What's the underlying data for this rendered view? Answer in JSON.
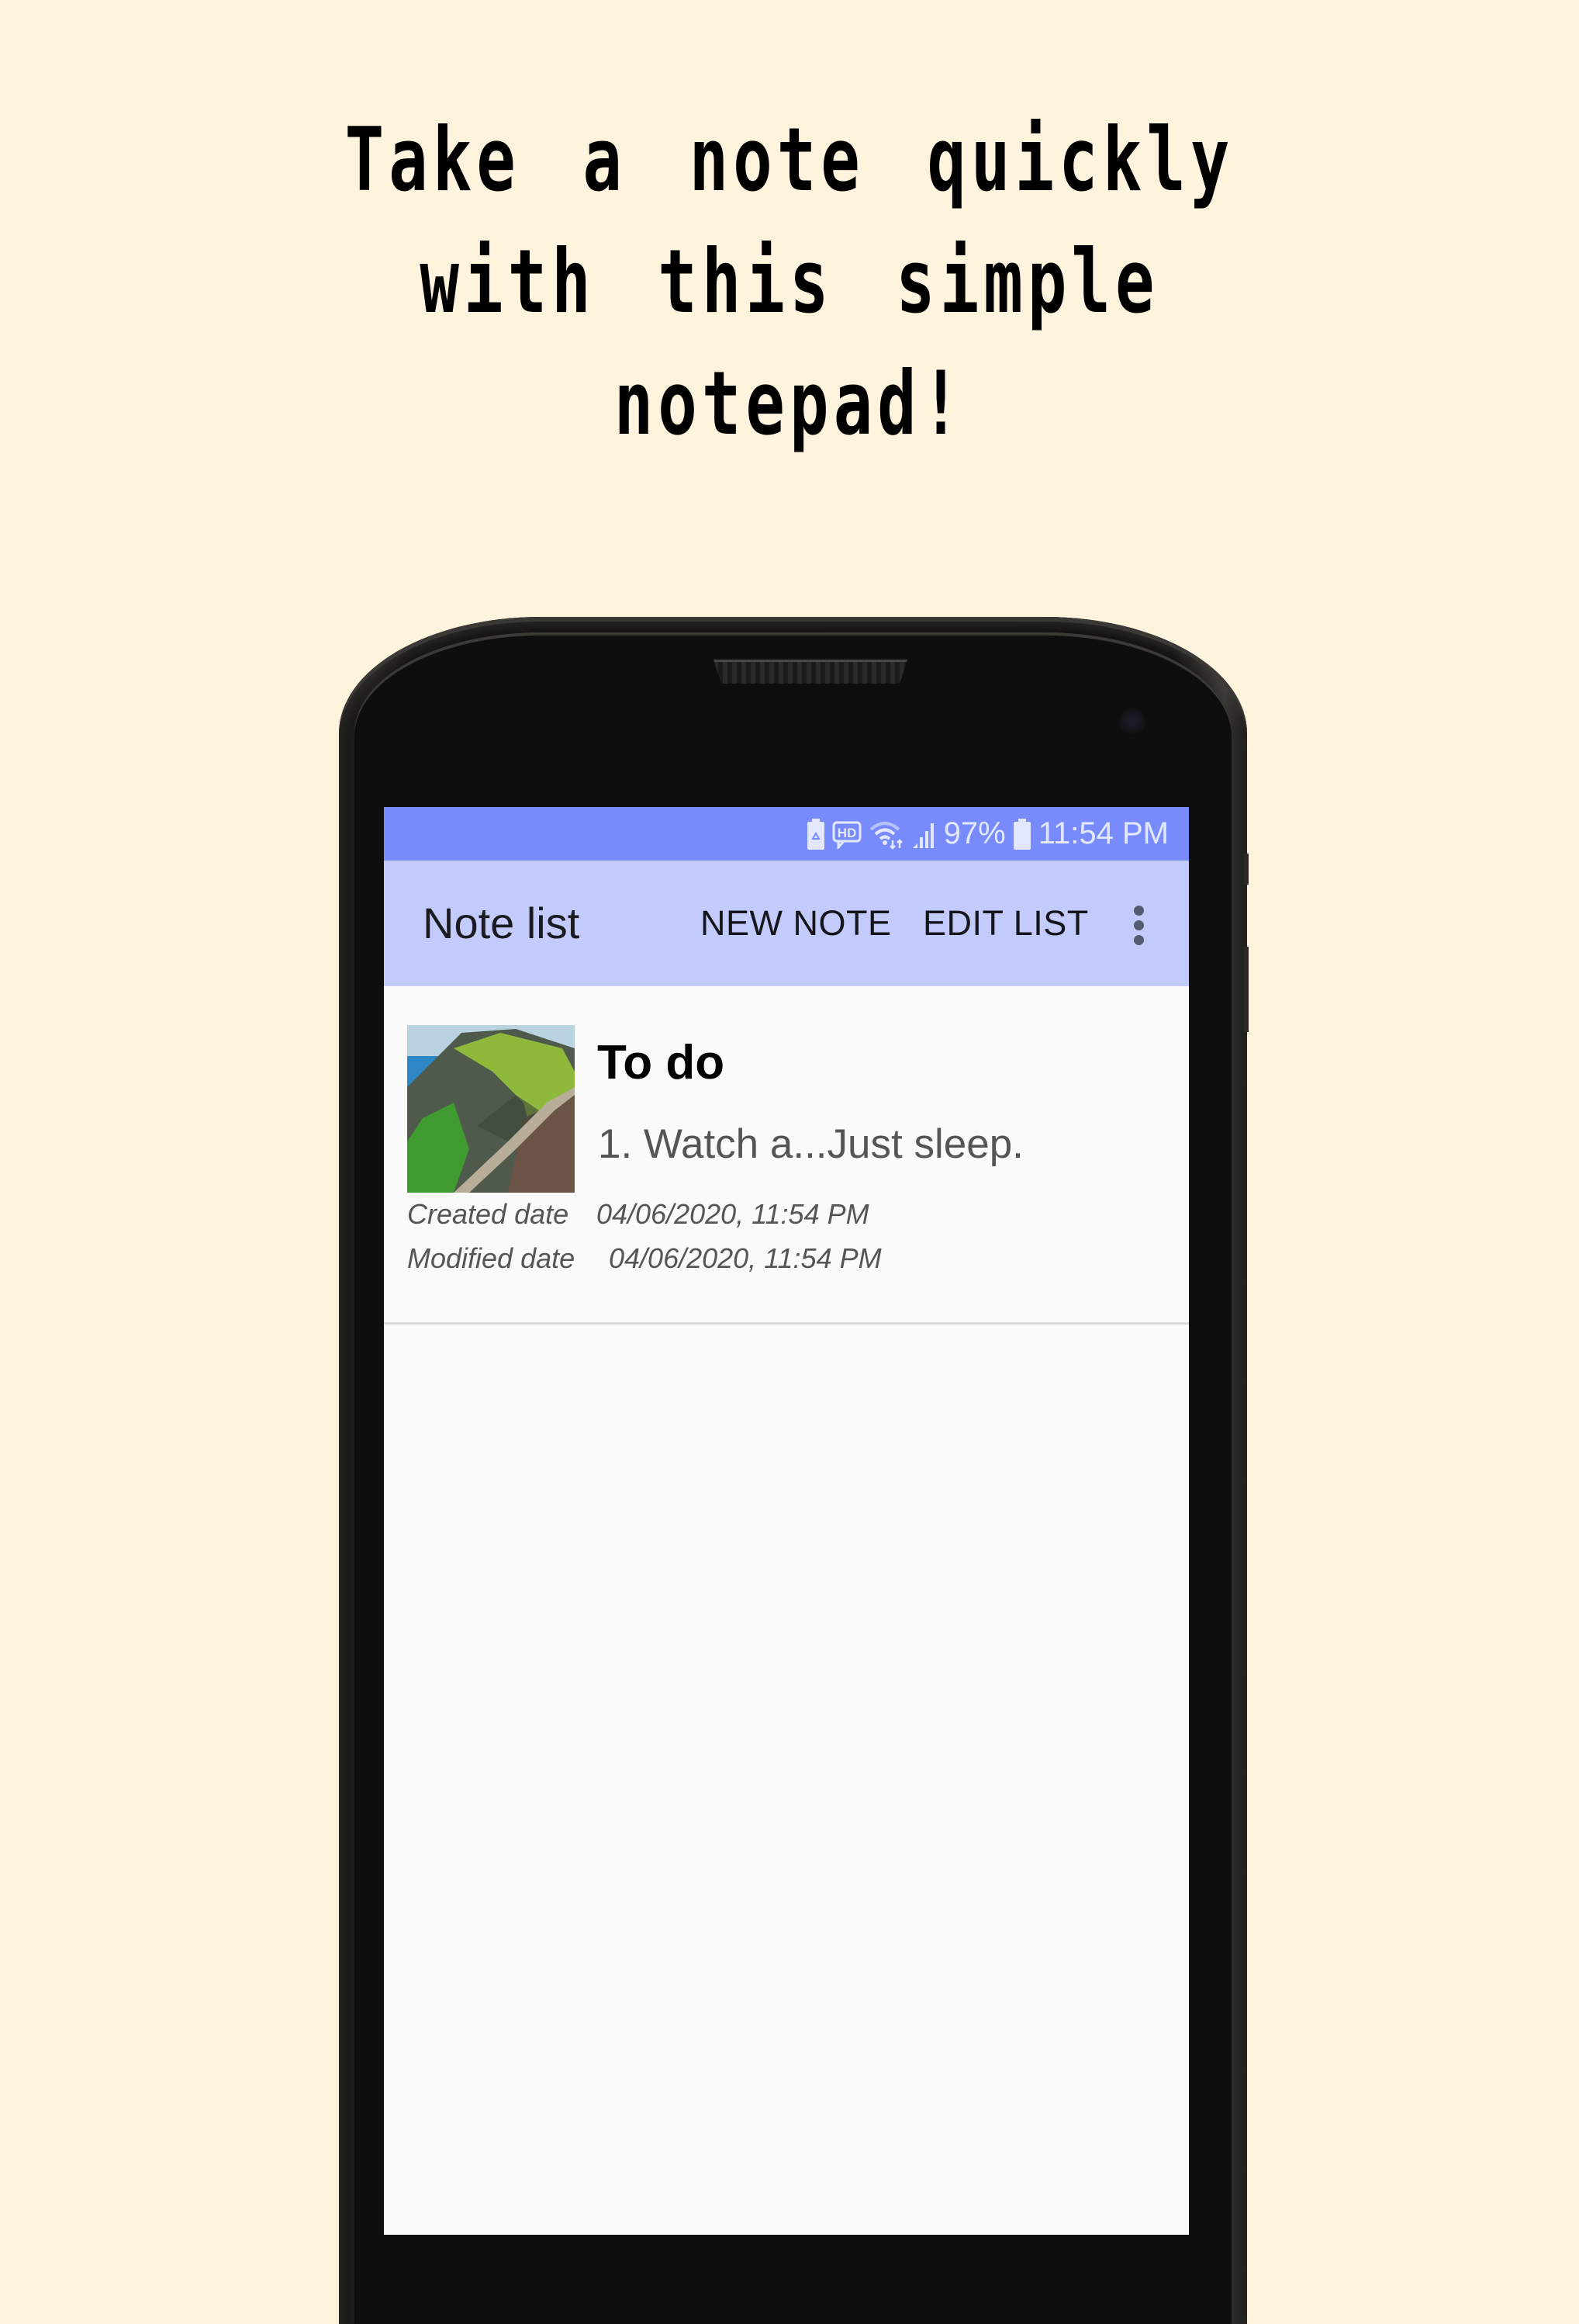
{
  "headline": {
    "lines": [
      "Take a note quickly",
      "with this simple",
      "notepad!"
    ]
  },
  "status_bar": {
    "icons": [
      "battery-saver-icon",
      "hd-voice-icon",
      "wifi-data-icon",
      "signal-icon",
      "battery-icon"
    ],
    "battery_percent": "97%",
    "time": "11:54 PM"
  },
  "app_bar": {
    "title": "Note list",
    "new_note_label": "NEW NOTE",
    "edit_list_label": "EDIT LIST",
    "overflow_icon": "more-vertical-icon"
  },
  "notes": [
    {
      "title": "To do",
      "preview": "1. Watch a...Just sleep.",
      "thumbnail": "coastal-cliff-rope-bridge-photo",
      "created_label": "Created date",
      "created_value": "04/06/2020, 11:54 PM",
      "modified_label": "Modified date",
      "modified_value": "04/06/2020, 11:54 PM"
    }
  ],
  "colors": {
    "background": "#fef3dc",
    "status_bar": "#788bfc",
    "app_bar": "#c3cafc",
    "list_background": "#fafafa"
  }
}
